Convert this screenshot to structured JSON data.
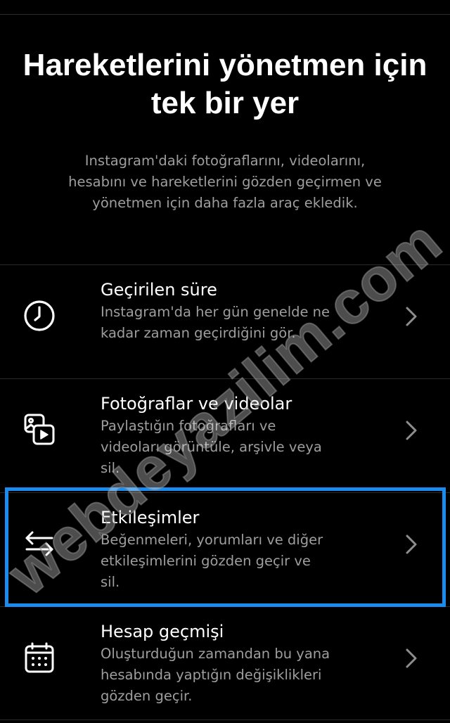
{
  "header": {
    "title": "Hareketlerini yönetmen için tek bir yer",
    "description": "Instagram'daki fotoğraflarını, videolarını, hesabını ve hareketlerini gözden geçirmen ve yönetmen için daha fazla araç ekledik."
  },
  "menu": {
    "items": [
      {
        "icon": "clock-icon",
        "title": "Geçirilen süre",
        "description": "Instagram'da her gün genelde ne kadar zaman geçirdiğini gör."
      },
      {
        "icon": "photos-videos-icon",
        "title": "Fotoğraflar ve videolar",
        "description": "Paylaştığın fotoğrafları ve videoları görüntüle, arşivle veya sil."
      },
      {
        "icon": "swap-arrows-icon",
        "title": "Etkileşimler",
        "description": "Beğenmeleri, yorumları ve diğer etkileşimlerini gözden geçir ve sil."
      },
      {
        "icon": "calendar-icon",
        "title": "Hesap geçmişi",
        "description": "Oluşturduğun zamandan bu yana hesabında yaptığın değişiklikleri gözden geçir."
      }
    ]
  },
  "watermark": {
    "text": "webdeyazilim.com"
  },
  "colors": {
    "background": "#000000",
    "text_primary": "#ffffff",
    "text_secondary": "#9e9e9e",
    "divider": "#2a2a2a",
    "highlight": "#1a8cf0"
  }
}
